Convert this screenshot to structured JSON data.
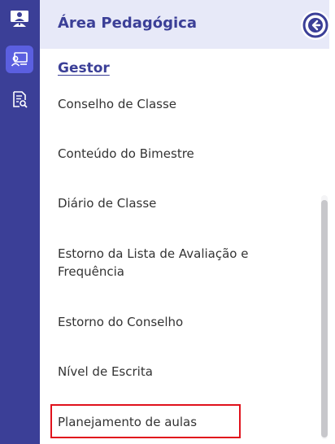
{
  "app": {
    "accent_color": "#3b3f97",
    "highlight_color": "#e0121c"
  },
  "rail": {
    "items": [
      {
        "icon": "teacher-icon",
        "active": false
      },
      {
        "icon": "classroom-board-icon",
        "active": true
      },
      {
        "icon": "document-search-icon",
        "active": false
      }
    ]
  },
  "panel": {
    "title": "Área Pedagógica",
    "collapse_icon": "arrow-left-circle-icon",
    "section": "Gestor",
    "items": [
      {
        "label": "Conselho de Classe"
      },
      {
        "label": "Conteúdo do Bimestre"
      },
      {
        "label": "Diário de Classe"
      },
      {
        "label": "Estorno da Lista de Avaliação e Frequência"
      },
      {
        "label": "Estorno do Conselho"
      },
      {
        "label": "Nível de Escrita"
      },
      {
        "label": "Planejamento de aulas",
        "highlighted": true
      }
    ]
  }
}
